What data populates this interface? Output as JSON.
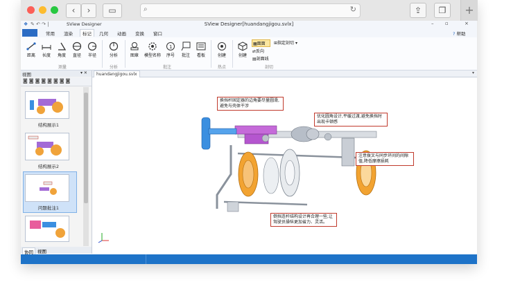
{
  "app": {
    "title": "SView Designer"
  },
  "window": {
    "title": "SView Designer[huandangjigou.svlx]",
    "help_label": "帮助"
  },
  "ribbon": {
    "tabs": [
      {
        "label": "常用"
      },
      {
        "label": "渲染"
      },
      {
        "label": "标记"
      },
      {
        "label": "几何"
      },
      {
        "label": "动画"
      },
      {
        "label": "变换"
      },
      {
        "label": "窗口"
      }
    ],
    "active_tab": "标记",
    "groups": {
      "measure": "测量",
      "analysis": "分析",
      "annotation": "批注",
      "hotspot": "热点",
      "section": "剖切"
    },
    "tools": {
      "distance": "距离",
      "length": "长度",
      "angle": "角度",
      "diameter": "直径",
      "radius": "半径",
      "analyze": "分析",
      "layer": "图章",
      "model_name": "模型名称",
      "sequence": "序号",
      "annotate": "批注",
      "board": "看板",
      "create_hotspot": "创建",
      "create_section": "创建",
      "plane": "面面",
      "reverse": "反向",
      "section_line": "剖面线",
      "specify_section": "指定剖切"
    }
  },
  "left_panel": {
    "header": "视图",
    "items": [
      {
        "label": "结构展示1"
      },
      {
        "label": "结构展示2"
      },
      {
        "label": "问题批注1"
      }
    ],
    "tabs": [
      {
        "label": "协同"
      },
      {
        "label": "视图"
      }
    ]
  },
  "document": {
    "tab_label": "huandangjigou.svlx",
    "callouts": [
      {
        "text": "换挡杆固定器的边角要尽量圆滑,避免与壳体干涉"
      },
      {
        "text": "优化圆角设计,平缓过渡,避免换挡时出现卡顿感"
      },
      {
        "text": "注意拨叉与同步环间的间隙值,降低摩擦损耗"
      },
      {
        "text": "倒挡连杆结构设计再合理一些,让驾驶员操纵更加省力、灵活。"
      }
    ]
  },
  "colors": {
    "accent": "#1e73c8",
    "callout_border": "#c0392b",
    "selected": "#cfe2f8"
  }
}
